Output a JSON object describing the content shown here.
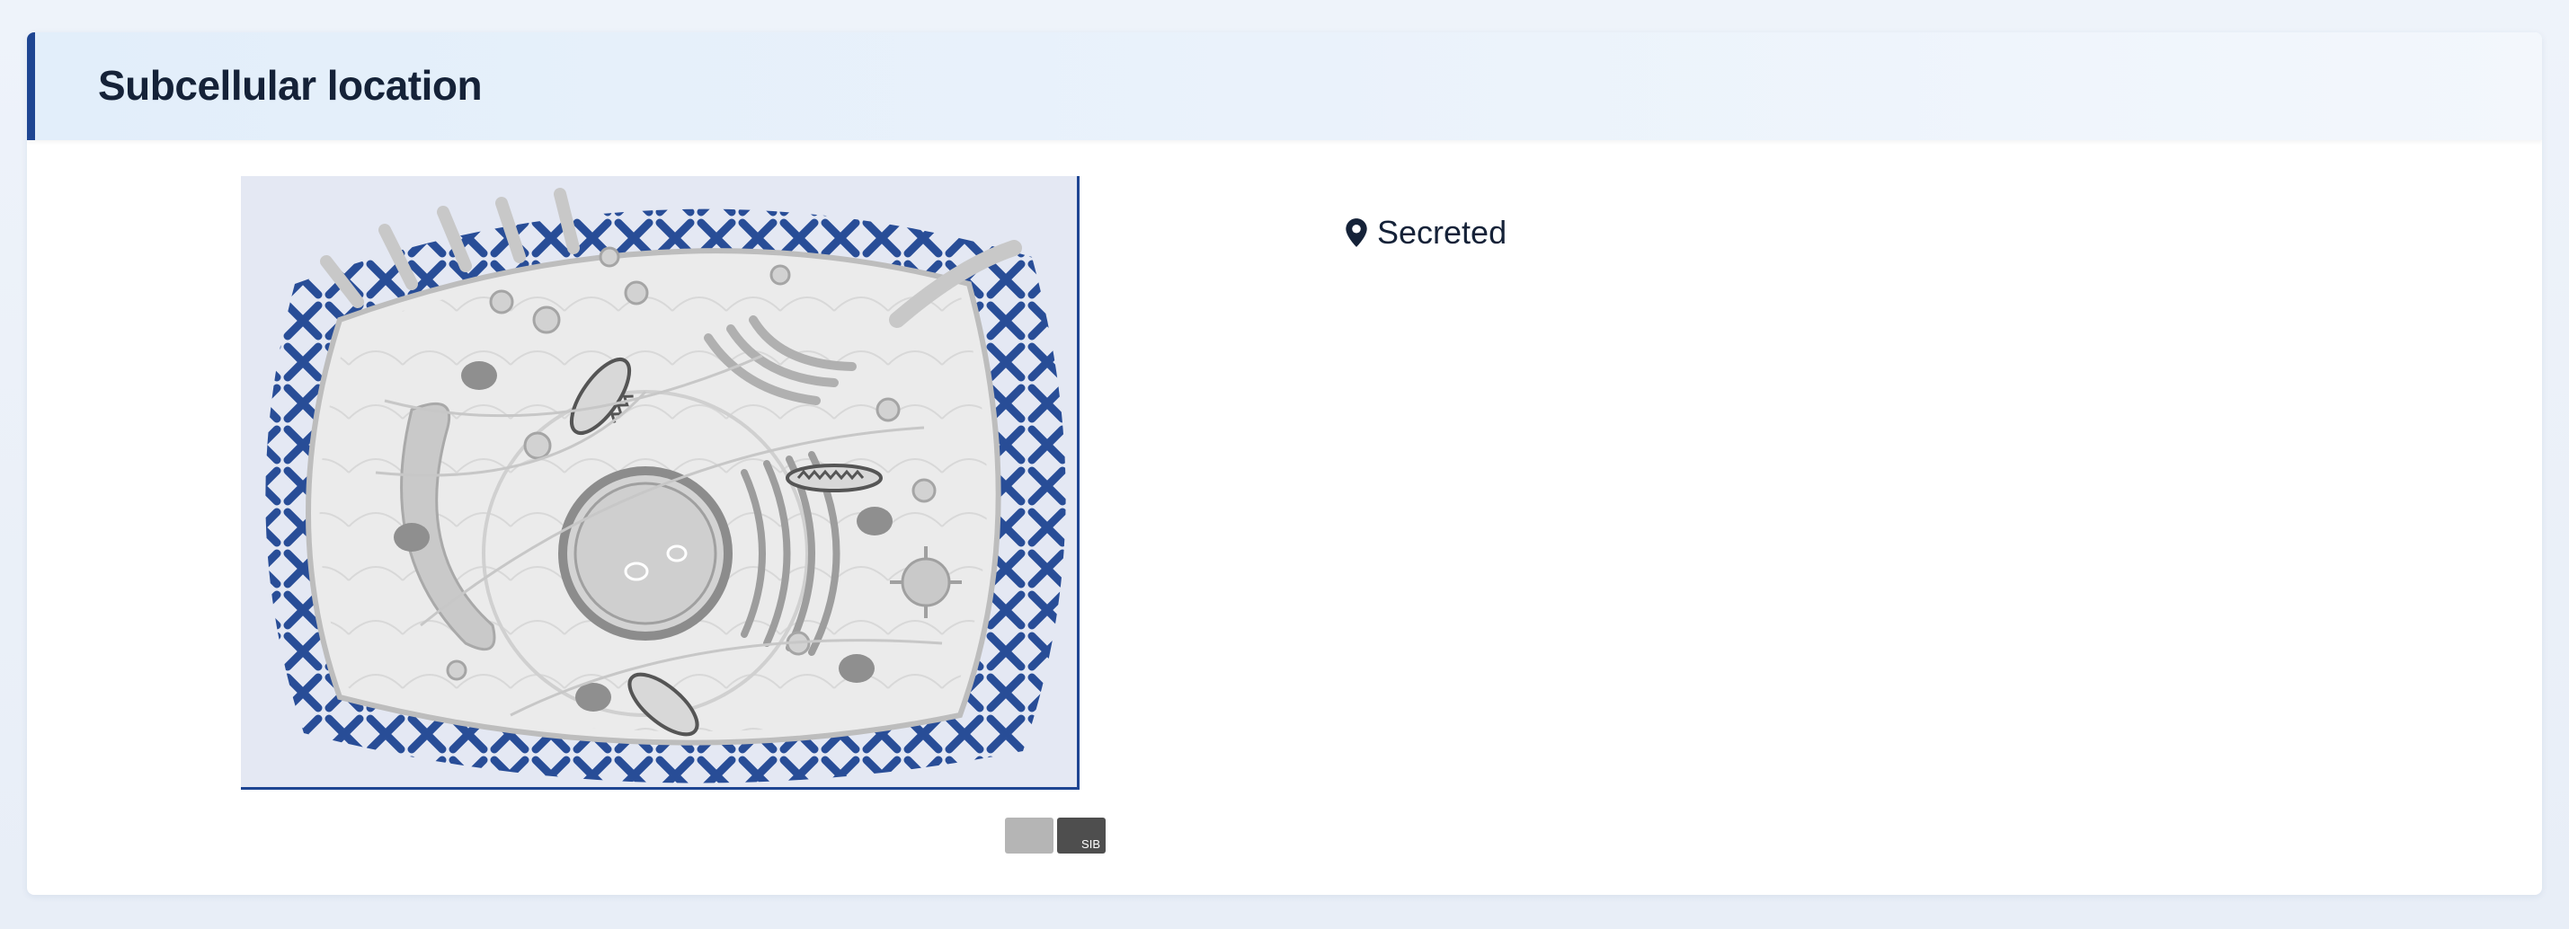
{
  "section": {
    "title": "Subcellular location"
  },
  "figure": {
    "image_name": "cell-diagram",
    "highlight_color": "#1e4592",
    "logos": [
      "swissbio-logo",
      "sib-logo"
    ],
    "sib_logo_text": "SIB"
  },
  "locations": [
    {
      "icon": "map-pin-icon",
      "label": "Secreted"
    }
  ],
  "colors": {
    "accent": "#1e4592",
    "header_bg": "#e6f0fa",
    "text": "#152238"
  }
}
